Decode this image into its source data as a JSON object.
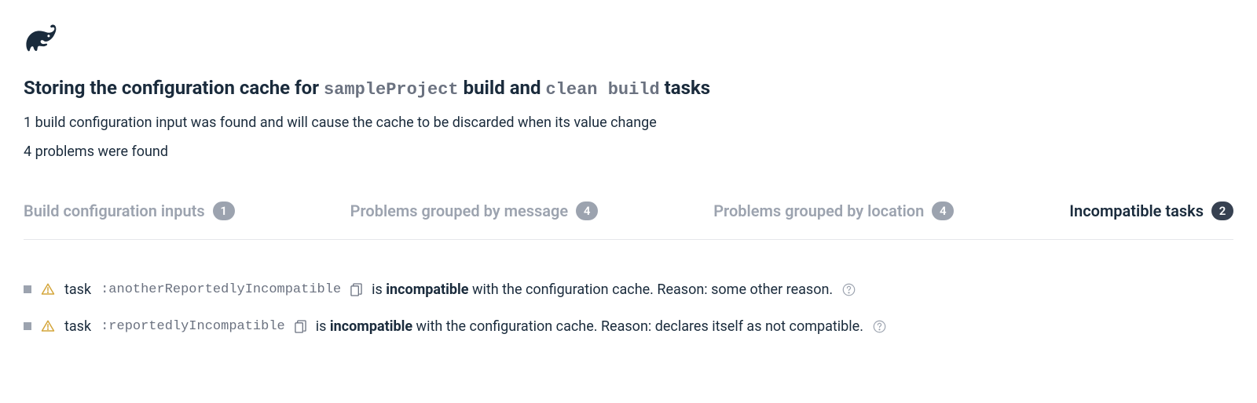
{
  "header": {
    "title_prefix": "Storing the configuration cache for ",
    "project_name": "sampleProject",
    "title_mid": " build and ",
    "tasks_name": "clean build",
    "title_suffix": " tasks",
    "subtitle1": "1 build configuration input was found and will cause the cache to be discarded when its value change",
    "subtitle2": "4 problems were found"
  },
  "tabs": [
    {
      "label": "Build configuration inputs",
      "count": "1",
      "active": false
    },
    {
      "label": "Problems grouped by message",
      "count": "4",
      "active": false
    },
    {
      "label": "Problems grouped by location",
      "count": "4",
      "active": false
    },
    {
      "label": "Incompatible tasks",
      "count": "2",
      "active": true
    }
  ],
  "tasks": [
    {
      "task_label": "task",
      "task_name": ":anotherReportedlyIncompatible",
      "desc_prefix": "is ",
      "desc_bold": "incompatible",
      "desc_suffix": " with the configuration cache. Reason: some other reason."
    },
    {
      "task_label": "task",
      "task_name": ":reportedlyIncompatible",
      "desc_prefix": "is ",
      "desc_bold": "incompatible",
      "desc_suffix": " with the configuration cache. Reason: declares itself as not compatible."
    }
  ]
}
